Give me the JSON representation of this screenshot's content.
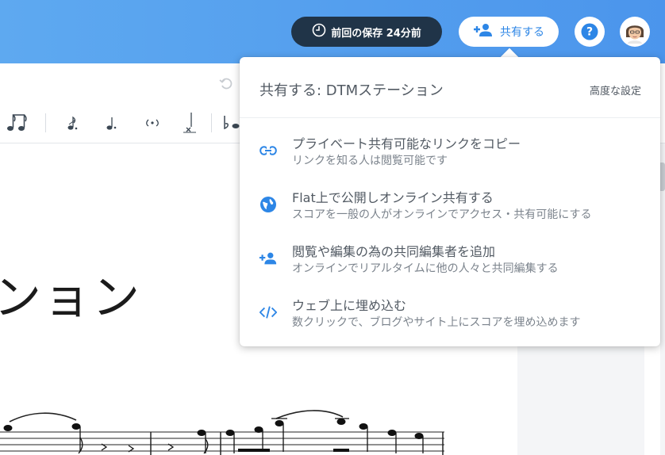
{
  "header": {
    "save_status": "前回の保存 24分前",
    "share_label": "共有する",
    "help_symbol": "?"
  },
  "score": {
    "title_fragment": "ンョン"
  },
  "share_popover": {
    "title": "共有する: DTMステーション",
    "advanced_label": "高度な設定",
    "options": [
      {
        "icon": "link-icon",
        "title": "プライベート共有可能なリンクをコピー",
        "subtitle": "リンクを知る人は閲覧可能です"
      },
      {
        "icon": "globe-icon",
        "title": "Flat上で公開しオンライン共有する",
        "subtitle": "スコアを一般の人がオンラインでアクセス・共有可能にする"
      },
      {
        "icon": "add-person-icon",
        "title": "閲覧や編集の為の共同編集者を追加",
        "subtitle": "オンラインでリアルタイムに他の人々と共同編集する"
      },
      {
        "icon": "embed-code-icon",
        "title": "ウェブ上に埋め込む",
        "subtitle": "数クリックで、ブログやサイト上にスコアを埋め込めます"
      }
    ]
  },
  "colors": {
    "header_blue": "#4b95ec",
    "save_pill": "#203448",
    "accent": "#2d86e6"
  }
}
